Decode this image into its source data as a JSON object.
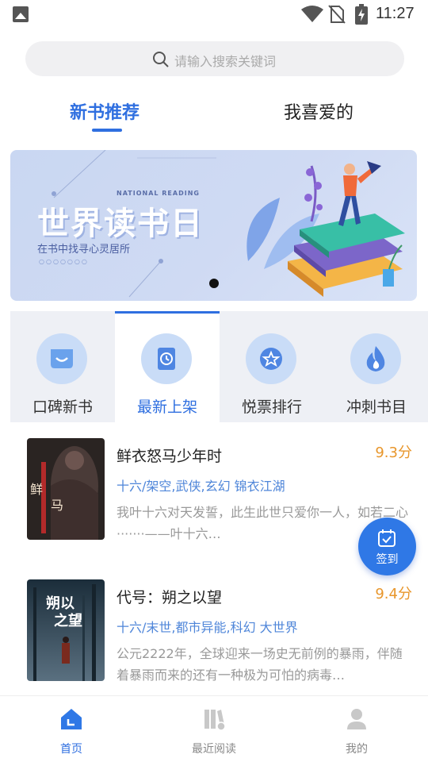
{
  "status_bar": {
    "time": "11:27",
    "icons": [
      "image-icon",
      "wifi-icon",
      "no-sim-icon",
      "battery-charging-icon"
    ]
  },
  "search": {
    "placeholder": "请输入搜索关键词",
    "icon": "search-icon"
  },
  "tabs": [
    {
      "label": "新书推荐",
      "active": true
    },
    {
      "label": "我喜爱的",
      "active": false
    }
  ],
  "banner": {
    "english_caption": "NATIONAL READING",
    "title": "世界读书日",
    "subtitle": "在书中找寻心灵居所",
    "decoration": "○○○○○○○",
    "page_count": 1,
    "active_page": 1
  },
  "categories": [
    {
      "label": "口碑新书",
      "icon": "chat-bubble-icon",
      "active": false
    },
    {
      "label": "最新上架",
      "icon": "clock-book-icon",
      "active": true
    },
    {
      "label": "悦票排行",
      "icon": "star-badge-icon",
      "active": false
    },
    {
      "label": "冲刺书目",
      "icon": "flame-icon",
      "active": false
    }
  ],
  "books": [
    {
      "title": "鲜衣怒马少年时",
      "score": "9.3分",
      "meta": "十六/架空,武侠,玄幻 锦衣江湖",
      "description": "我叶十六对天发誓，此生此世只爱你一人，如若二心·······——叶十六…",
      "cover_text": "鲜衣怒马少年时"
    },
    {
      "title": "代号：朔之以望",
      "score": "9.4分",
      "meta": "十六/末世,都市异能,科幻 大世界",
      "description": "公元2222年，全球迎来一场史无前例的暴雨，伴随着暴雨而来的还有一种极为可怕的病毒…",
      "cover_text": "朔以之望"
    }
  ],
  "fab": {
    "label": "签到",
    "icon": "calendar-check-icon"
  },
  "bottom_nav": [
    {
      "label": "首页",
      "icon": "home-icon",
      "active": true
    },
    {
      "label": "最近阅读",
      "icon": "bookshelf-icon",
      "active": false
    },
    {
      "label": "我的",
      "icon": "user-icon",
      "active": false
    }
  ],
  "colors": {
    "accent": "#2f6fe0",
    "score": "#e8962b",
    "meta": "#4f86d9"
  }
}
